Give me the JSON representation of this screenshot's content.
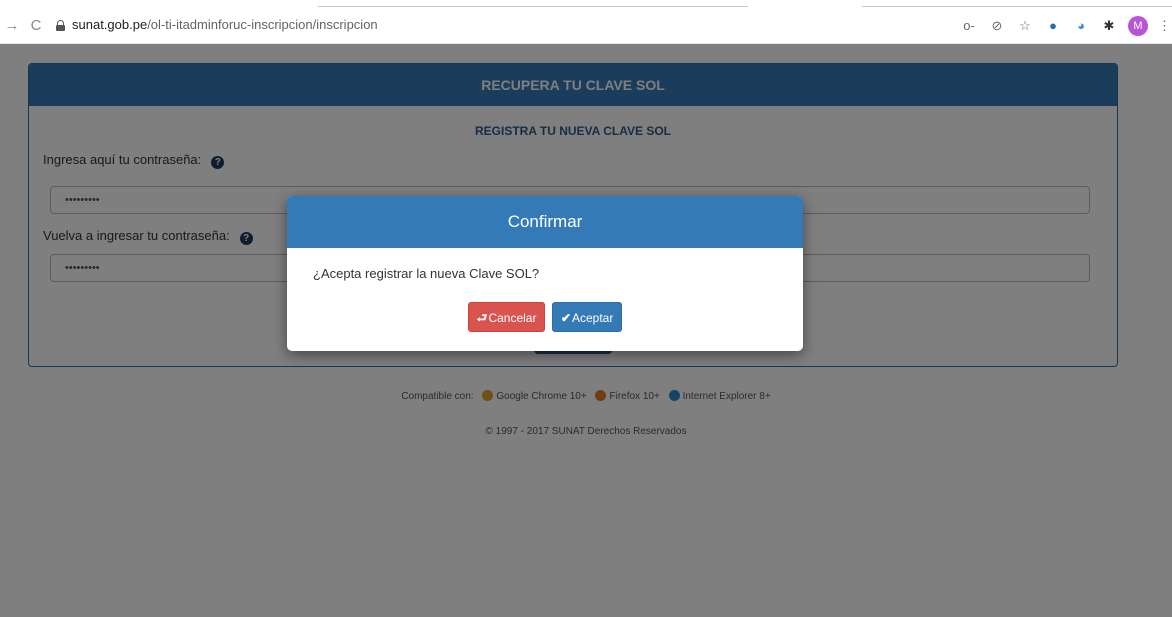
{
  "browser": {
    "url_host": "sunat.gob.pe",
    "url_path": "/ol-ti-itadminforuc-inscripcion/inscripcion",
    "back_glyph": "→",
    "reload_glyph": "C",
    "avatar_initial": "M",
    "extensions": [
      "key-icon",
      "eye-off-icon",
      "star-icon",
      "extension-icon",
      "extension-icon",
      "puzzle-icon"
    ]
  },
  "panel": {
    "heading": "RECUPERA TU CLAVE SOL",
    "subtitle": "REGISTRA TU NUEVA CLAVE SOL",
    "password_label": "Ingresa aquí tu contraseña:",
    "password_value": "•••••••••",
    "confirm_label": "Vuelva a ingresar tu contraseña:",
    "confirm_value": "•••••••••",
    "help_glyph": "?"
  },
  "footer": {
    "compat_prefix": "Compatible con:",
    "browsers": [
      "Google Chrome 10+",
      "Firefox 10+",
      "Internet Explorer 8+"
    ],
    "browser_colors": [
      "#e0a02b",
      "#e8771e",
      "#2b8ac9"
    ],
    "copyright": "© 1997 - 2017 SUNAT Derechos Reservados"
  },
  "modal": {
    "title": "Confirmar",
    "message": "¿Acepta registrar la nueva Clave SOL?",
    "cancel_label": "Cancelar",
    "cancel_icon": "⮐",
    "accept_label": "Aceptar",
    "accept_icon": "✔"
  },
  "colors": {
    "primary": "#337ab7",
    "danger": "#d9534f"
  }
}
